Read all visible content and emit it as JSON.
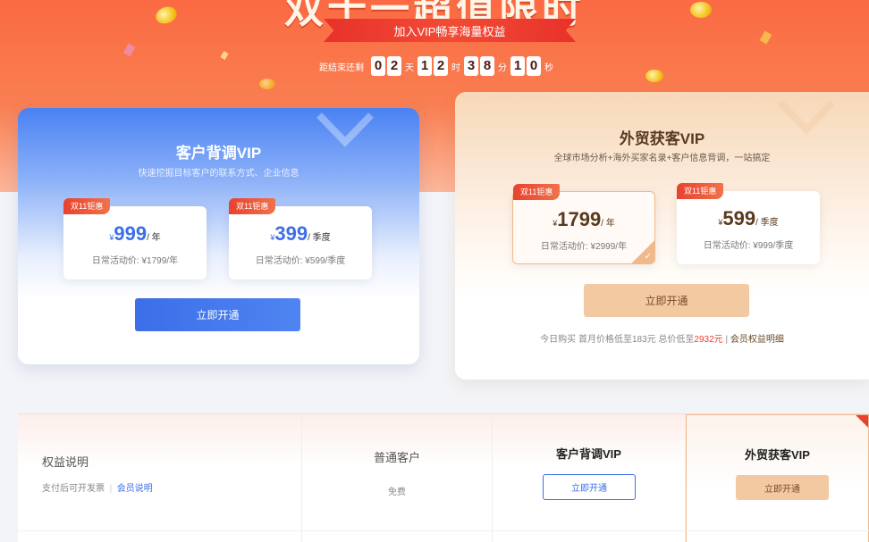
{
  "banner": {
    "title": "双十一超值限时",
    "ribbon_text": "加入VIP畅享海量权益",
    "countdown_label": "距结束还剩",
    "days": [
      "0",
      "2"
    ],
    "day_unit": "天",
    "hours": [
      "1",
      "2"
    ],
    "hour_unit": "时",
    "minutes": [
      "3",
      "8"
    ],
    "minute_unit": "分",
    "seconds": [
      "1",
      "0"
    ],
    "second_unit": "秒"
  },
  "card_blue": {
    "title": "客户背调VIP",
    "subtitle": "快速挖掘目标客户的联系方式、企业信息",
    "plans": [
      {
        "tag": "双11钜惠",
        "currency": "¥",
        "price": "999",
        "unit": "/ 年",
        "daily": "日常活动价: ¥1799/年"
      },
      {
        "tag": "双11钜惠",
        "currency": "¥",
        "price": "399",
        "unit": "/ 季度",
        "daily": "日常活动价: ¥599/季度"
      }
    ],
    "button": "立即开通",
    "accent": "#3c6fe8"
  },
  "card_gold": {
    "title": "外贸获客VIP",
    "subtitle": "全球市场分析+海外买家名录+客户信息背调，一站搞定",
    "plans": [
      {
        "tag": "双11钜惠",
        "currency": "¥",
        "price": "1799",
        "unit": "/ 年",
        "daily": "日常活动价: ¥2999/年",
        "selected": true
      },
      {
        "tag": "双11钜惠",
        "currency": "¥",
        "price": "599",
        "unit": "/ 季度",
        "daily": "日常活动价: ¥999/季度",
        "selected": false
      }
    ],
    "button": "立即开通",
    "note_prefix": "今日购买 首月价格低至183元 总价低至",
    "note_total": "2932元",
    "note_sep": " | ",
    "note_link": "会员权益明细",
    "accent": "#f3c9a2"
  },
  "compare": {
    "benefit_title": "权益说明",
    "benefit_sub": "支付后可开发票",
    "benefit_sep": "|",
    "benefit_link": "会员说明",
    "columns": [
      {
        "title": "普通客户",
        "value": "免费"
      },
      {
        "title": "客户背调VIP",
        "button": "立即开通"
      },
      {
        "title": "外贸获客VIP",
        "button": "立即开通"
      }
    ]
  },
  "colors": {
    "hero": "#fb6a42",
    "discount_tag": "#e8422f"
  },
  "icons": {
    "selected_check": "check-icon",
    "coin": "gold-coin-icon"
  }
}
